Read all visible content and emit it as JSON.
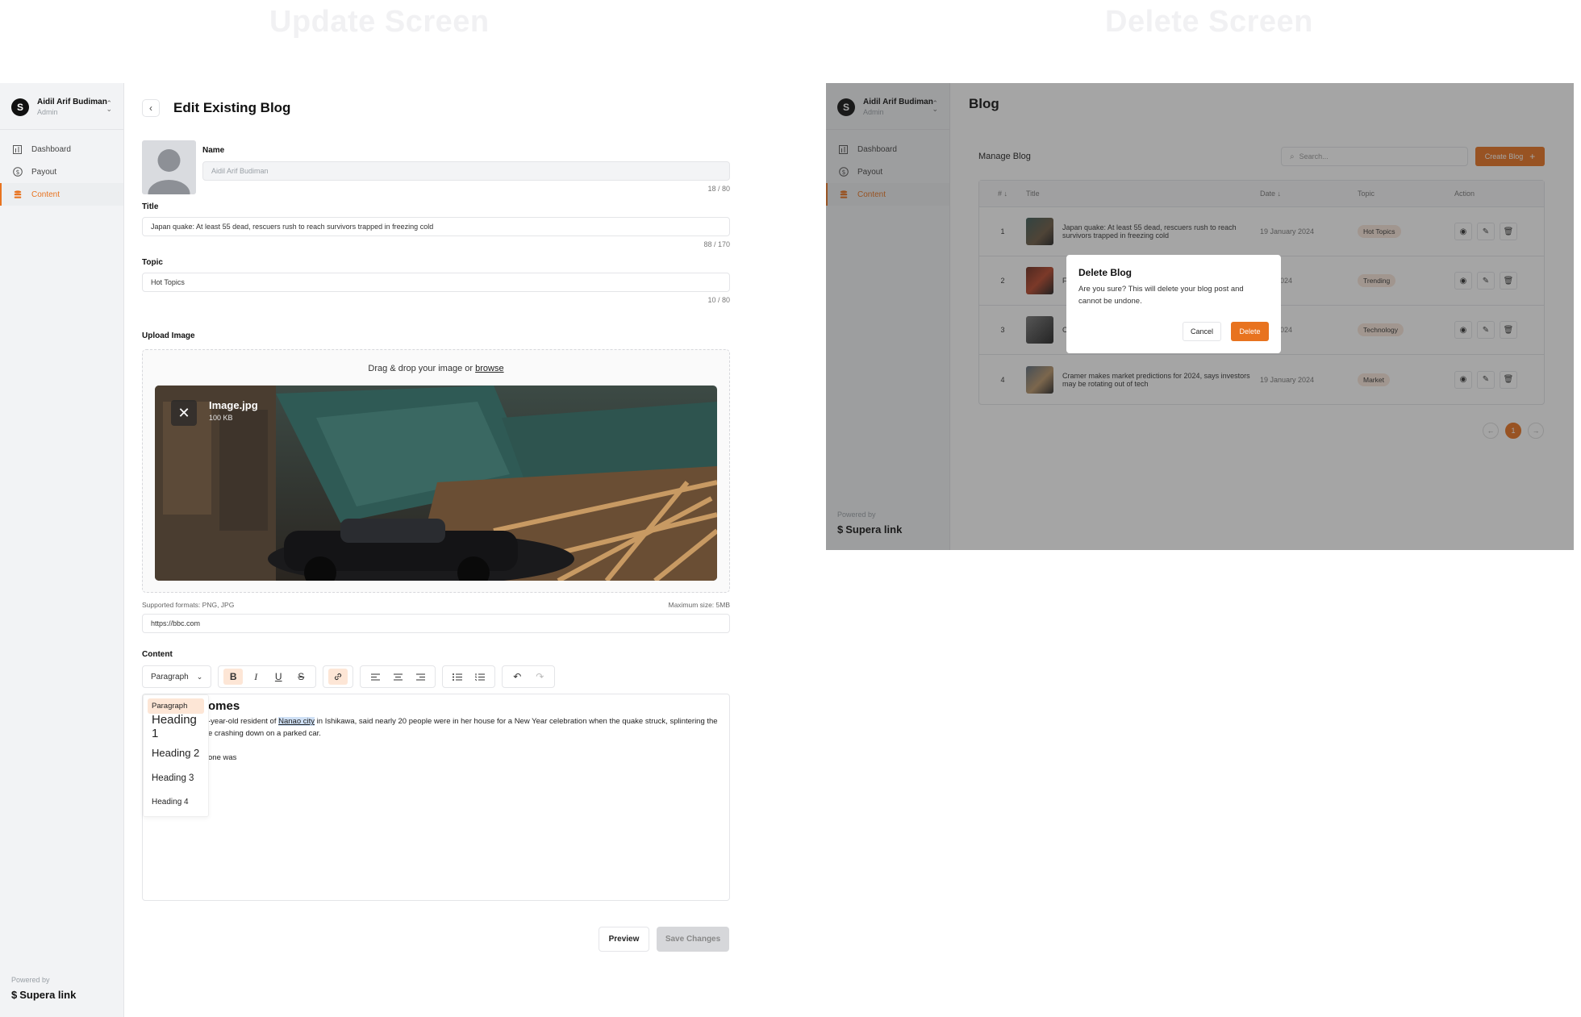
{
  "labels": {
    "update_screen": "Update Screen",
    "delete_screen": "Delete Screen"
  },
  "sidebar": {
    "user_name": "Aidil Arif Budiman",
    "user_role": "Admin",
    "items": [
      {
        "label": "Dashboard",
        "icon": "bar-chart-icon"
      },
      {
        "label": "Payout",
        "icon": "dollar-circle-icon"
      },
      {
        "label": "Content",
        "icon": "database-icon"
      }
    ],
    "powered_by": "Powered by",
    "brand": "Supera link"
  },
  "update": {
    "page_title": "Edit Existing Blog",
    "name_label": "Name",
    "name_value": "Aidil Arif Budiman",
    "name_counter": "18 / 80",
    "title_label": "Title",
    "title_value": "Japan quake: At least 55 dead, rescuers rush to reach survivors trapped in freezing cold",
    "title_counter": "88 / 170",
    "topic_label": "Topic",
    "topic_value": "Hot Topics",
    "topic_counter": "10 / 80",
    "upload_label": "Upload Image",
    "upload_hint": "Drag & drop your image or",
    "upload_link": "browse",
    "file_name": "Image.jpg",
    "file_size": "100 KB",
    "formats": "Supported formats: PNG, JPG",
    "max_size": "Maximum size: 5MB",
    "url_value": "https://bbc.com",
    "content_label": "Content",
    "block_select": "Paragraph",
    "dropdown_options": [
      "Paragraph",
      "Heading 1",
      "Heading 2",
      "Heading 3",
      "Heading 4"
    ],
    "editor_heading": "omes",
    "editor_text_before": "-year-old resident of",
    "editor_highlight": "Nanao city",
    "editor_text_after": "in Ishikawa, said nearly 20 people were in her house for a New Year celebration when the quake struck, splintering the",
    "editor_line2": "e crashing down on a parked car.",
    "editor_line3": "one was",
    "preview_label": "Preview",
    "save_label": "Save Changes"
  },
  "delete": {
    "page_title": "Blog",
    "manage_label": "Manage Blog",
    "search_placeholder": "Search...",
    "create_label": "Create Blog",
    "columns": [
      "# ↓",
      "Title",
      "Date ↓",
      "Topic",
      "Action"
    ],
    "rows": [
      {
        "no": "1",
        "title": "Japan quake: At least 55 dead, rescuers rush to reach survivors trapped in freezing cold",
        "date": "19 January 2024",
        "topic": "Hot Topics"
      },
      {
        "no": "2",
        "title": "F p",
        "date": "uary 2024",
        "topic": "Trending"
      },
      {
        "no": "3",
        "title": "C v",
        "date": "uary 2024",
        "topic": "Technology"
      },
      {
        "no": "4",
        "title": "Cramer makes market predictions for 2024, says investors may be rotating out of tech",
        "date": "19 January 2024",
        "topic": "Market"
      }
    ],
    "page_current": "1",
    "modal_title": "Delete Blog",
    "modal_text": "Are you sure? This will delete your blog post and cannot be undone.",
    "modal_cancel": "Cancel",
    "modal_delete": "Delete"
  },
  "colors": {
    "accent": "#e8731f",
    "sidebar_bg": "#f2f3f5",
    "tag_bg": "#f9e6d9"
  }
}
